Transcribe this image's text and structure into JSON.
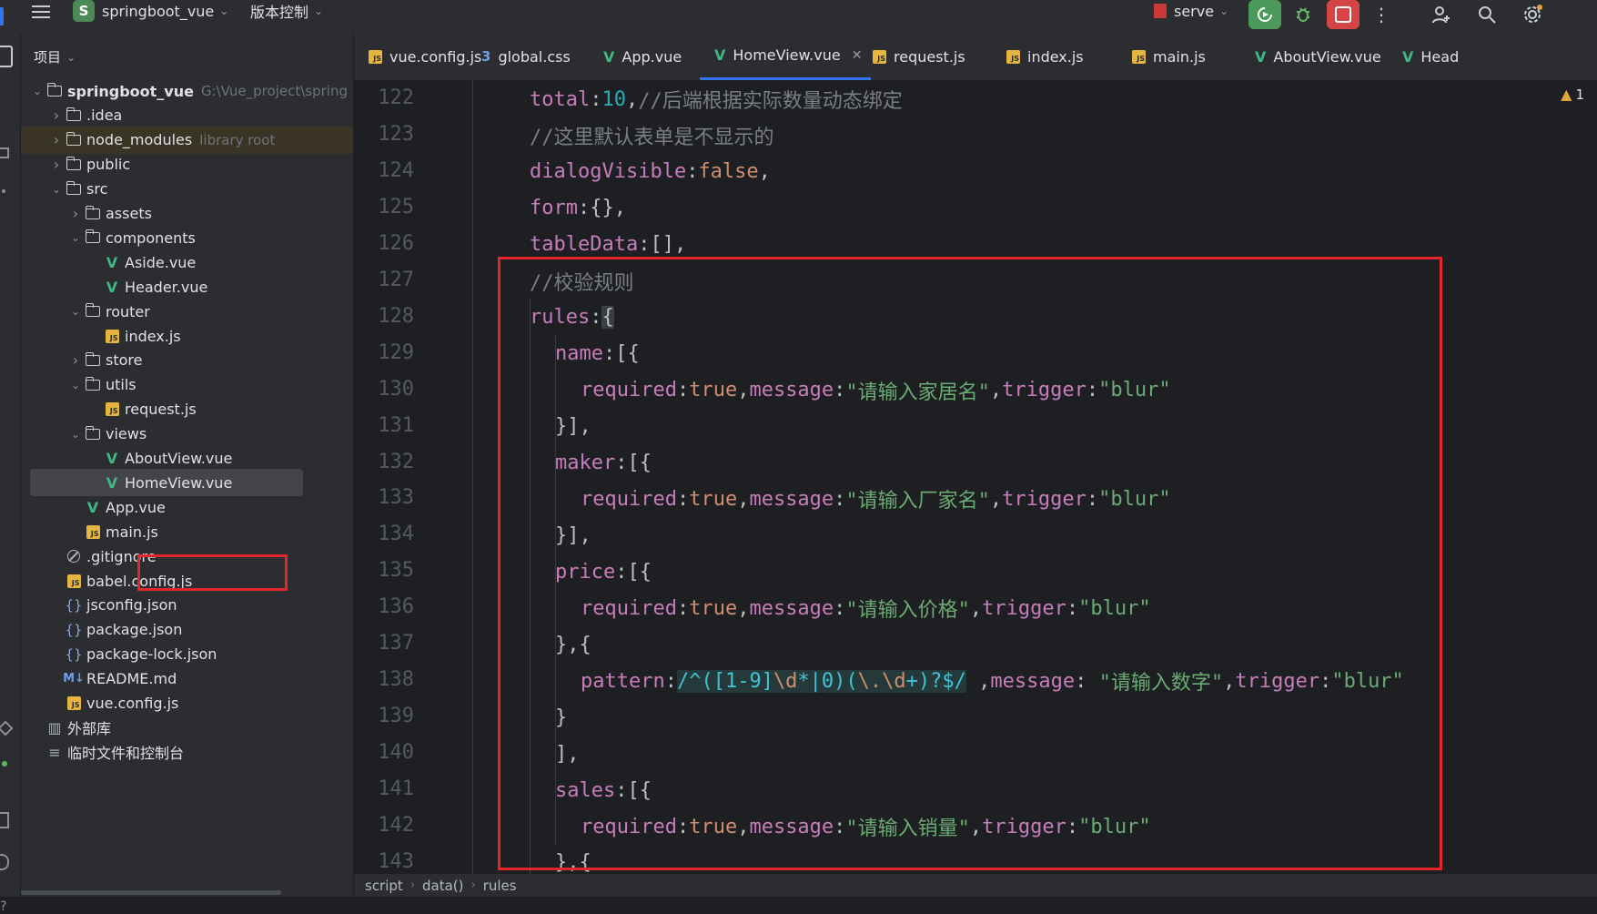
{
  "topbar": {
    "menu_icon": "hamburger-icon",
    "project_badge": "S",
    "project_name": "springboot_vue",
    "vcs_menu": "版本控制",
    "run_config": "serve",
    "colors": {
      "badge": "#4b8a55",
      "run": "#4b9a59",
      "stop": "#d64545"
    }
  },
  "sidebar": {
    "title": "项目",
    "tree": [
      {
        "label": "springboot_vue",
        "hint": "G:\\Vue_project\\spring",
        "icon": "module-folder-icon",
        "depth": 0,
        "expanded": true,
        "bold": true
      },
      {
        "label": ".idea",
        "icon": "folder-icon",
        "depth": 1,
        "expanded": false
      },
      {
        "label": "node_modules",
        "hint": "library root",
        "icon": "folder-icon",
        "depth": 1,
        "expanded": false,
        "highlighted": true
      },
      {
        "label": "public",
        "icon": "folder-icon",
        "depth": 1,
        "expanded": false
      },
      {
        "label": "src",
        "icon": "folder-icon",
        "depth": 1,
        "expanded": true
      },
      {
        "label": "assets",
        "icon": "folder-icon",
        "depth": 2,
        "expanded": false
      },
      {
        "label": "components",
        "icon": "folder-icon",
        "depth": 2,
        "expanded": true
      },
      {
        "label": "Aside.vue",
        "icon": "vue-icon",
        "depth": 3
      },
      {
        "label": "Header.vue",
        "icon": "vue-icon",
        "depth": 3
      },
      {
        "label": "router",
        "icon": "folder-icon",
        "depth": 2,
        "expanded": true
      },
      {
        "label": "index.js",
        "icon": "js-icon",
        "depth": 3
      },
      {
        "label": "store",
        "icon": "folder-icon",
        "depth": 2,
        "expanded": false
      },
      {
        "label": "utils",
        "icon": "folder-icon",
        "depth": 2,
        "expanded": true
      },
      {
        "label": "request.js",
        "icon": "js-icon",
        "depth": 3
      },
      {
        "label": "views",
        "icon": "folder-icon",
        "depth": 2,
        "expanded": true
      },
      {
        "label": "AboutView.vue",
        "icon": "vue-icon",
        "depth": 3
      },
      {
        "label": "HomeView.vue",
        "icon": "vue-icon",
        "depth": 3,
        "selected": true
      },
      {
        "label": "App.vue",
        "icon": "vue-icon",
        "depth": 2
      },
      {
        "label": "main.js",
        "icon": "js-icon",
        "depth": 2
      },
      {
        "label": ".gitignore",
        "icon": "ignore-icon",
        "depth": 1
      },
      {
        "label": "babel.config.js",
        "icon": "js-icon",
        "depth": 1
      },
      {
        "label": "jsconfig.json",
        "icon": "json-icon",
        "depth": 1
      },
      {
        "label": "package.json",
        "icon": "json-icon",
        "depth": 1
      },
      {
        "label": "package-lock.json",
        "icon": "json-icon",
        "depth": 1
      },
      {
        "label": "README.md",
        "icon": "markdown-icon",
        "depth": 1
      },
      {
        "label": "vue.config.js",
        "icon": "js-icon",
        "depth": 1
      },
      {
        "label": "外部库",
        "icon": "library-icon",
        "depth": 0
      },
      {
        "label": "临时文件和控制台",
        "icon": "scratch-icon",
        "depth": 0
      }
    ]
  },
  "tabs": [
    {
      "label": "vue.config.js",
      "icon": "js-icon"
    },
    {
      "label": "global.css",
      "icon": "css-icon"
    },
    {
      "label": "App.vue",
      "icon": "vue-icon"
    },
    {
      "label": "HomeView.vue",
      "icon": "vue-icon",
      "active": true,
      "closable": true
    },
    {
      "label": "request.js",
      "icon": "js-icon"
    },
    {
      "label": "index.js",
      "icon": "js-icon"
    },
    {
      "label": "main.js",
      "icon": "js-icon"
    },
    {
      "label": "AboutView.vue",
      "icon": "vue-icon"
    },
    {
      "label": "Head",
      "icon": "vue-icon"
    }
  ],
  "editor": {
    "warnings": "1",
    "lines": [
      {
        "n": "122",
        "indent": 0,
        "tokens": [
          [
            "total",
            "key"
          ],
          [
            ":",
            "p"
          ],
          [
            "10",
            "num"
          ],
          [
            ",",
            "p"
          ],
          [
            "//后端根据实际数量动态绑定",
            "cmt"
          ]
        ]
      },
      {
        "n": "123",
        "indent": 0,
        "tokens": [
          [
            "//这里默认表单是不显示的",
            "cmt"
          ]
        ]
      },
      {
        "n": "124",
        "indent": 0,
        "tokens": [
          [
            "dialogVisible",
            "key"
          ],
          [
            ":",
            "p"
          ],
          [
            "false",
            "kw"
          ],
          [
            ",",
            "p"
          ]
        ]
      },
      {
        "n": "125",
        "indent": 0,
        "tokens": [
          [
            "form",
            "key"
          ],
          [
            ":{},",
            "p"
          ]
        ]
      },
      {
        "n": "126",
        "indent": 0,
        "tokens": [
          [
            "tableData",
            "key"
          ],
          [
            ":[],",
            "p"
          ]
        ]
      },
      {
        "n": "127",
        "indent": 0,
        "tokens": [
          [
            "//校验规则",
            "cmt"
          ]
        ]
      },
      {
        "n": "128",
        "indent": 0,
        "tokens": [
          [
            "rules",
            "key"
          ],
          [
            ":",
            "p"
          ],
          [
            "{",
            "caret"
          ]
        ]
      },
      {
        "n": "129",
        "indent": 1,
        "tokens": [
          [
            "name",
            "key"
          ],
          [
            ":[{",
            "p"
          ]
        ]
      },
      {
        "n": "130",
        "indent": 2,
        "tokens": [
          [
            "required",
            "key"
          ],
          [
            ":",
            "p"
          ],
          [
            "true",
            "kw"
          ],
          [
            ",",
            "p"
          ],
          [
            "message",
            "key"
          ],
          [
            ":",
            "p"
          ],
          [
            "\"请输入家居名\"",
            "str"
          ],
          [
            ",",
            "p"
          ],
          [
            "trigger",
            "key"
          ],
          [
            ":",
            "p"
          ],
          [
            "\"blur\"",
            "str"
          ]
        ]
      },
      {
        "n": "131",
        "indent": 1,
        "tokens": [
          [
            "}],",
            "p"
          ]
        ]
      },
      {
        "n": "132",
        "indent": 1,
        "tokens": [
          [
            "maker",
            "key"
          ],
          [
            ":[{",
            "p"
          ]
        ]
      },
      {
        "n": "133",
        "indent": 2,
        "tokens": [
          [
            "required",
            "key"
          ],
          [
            ":",
            "p"
          ],
          [
            "true",
            "kw"
          ],
          [
            ",",
            "p"
          ],
          [
            "message",
            "key"
          ],
          [
            ":",
            "p"
          ],
          [
            "\"请输入厂家名\"",
            "str"
          ],
          [
            ",",
            "p"
          ],
          [
            "trigger",
            "key"
          ],
          [
            ":",
            "p"
          ],
          [
            "\"blur\"",
            "str"
          ]
        ]
      },
      {
        "n": "134",
        "indent": 1,
        "tokens": [
          [
            "}],",
            "p"
          ]
        ]
      },
      {
        "n": "135",
        "indent": 1,
        "tokens": [
          [
            "price",
            "key"
          ],
          [
            ":[{",
            "p"
          ]
        ]
      },
      {
        "n": "136",
        "indent": 2,
        "tokens": [
          [
            "required",
            "key"
          ],
          [
            ":",
            "p"
          ],
          [
            "true",
            "kw"
          ],
          [
            ",",
            "p"
          ],
          [
            "message",
            "key"
          ],
          [
            ":",
            "p"
          ],
          [
            "\"请输入价格\"",
            "str"
          ],
          [
            ",",
            "p"
          ],
          [
            "trigger",
            "key"
          ],
          [
            ":",
            "p"
          ],
          [
            "\"blur\"",
            "str"
          ]
        ]
      },
      {
        "n": "137",
        "indent": 1,
        "tokens": [
          [
            "},{",
            "p"
          ]
        ]
      },
      {
        "n": "138",
        "indent": 2,
        "tokens": [
          [
            "pattern",
            "key"
          ],
          [
            ":",
            "p"
          ],
          [
            "/^([1-9]",
            "re"
          ],
          [
            "\\d",
            "reesc"
          ],
          [
            "*|0)(",
            "re"
          ],
          [
            "\\.\\d",
            "reesc"
          ],
          [
            "+)?$/",
            "re"
          ],
          [
            " ,",
            "p"
          ],
          [
            "message",
            "key"
          ],
          [
            ": ",
            "p"
          ],
          [
            "\"请输入数字\"",
            "str"
          ],
          [
            ",",
            "p"
          ],
          [
            "trigger",
            "key"
          ],
          [
            ":",
            "p"
          ],
          [
            "\"blur\"",
            "str"
          ]
        ]
      },
      {
        "n": "139",
        "indent": 1,
        "tokens": [
          [
            "}",
            "p"
          ]
        ]
      },
      {
        "n": "140",
        "indent": 1,
        "tokens": [
          [
            "],",
            "p"
          ]
        ]
      },
      {
        "n": "141",
        "indent": 1,
        "tokens": [
          [
            "sales",
            "key"
          ],
          [
            ":[{",
            "p"
          ]
        ]
      },
      {
        "n": "142",
        "indent": 2,
        "tokens": [
          [
            "required",
            "key"
          ],
          [
            ":",
            "p"
          ],
          [
            "true",
            "kw"
          ],
          [
            ",",
            "p"
          ],
          [
            "message",
            "key"
          ],
          [
            ":",
            "p"
          ],
          [
            "\"请输入销量\"",
            "str"
          ],
          [
            ",",
            "p"
          ],
          [
            "trigger",
            "key"
          ],
          [
            ":",
            "p"
          ],
          [
            "\"blur\"",
            "str"
          ]
        ]
      },
      {
        "n": "143",
        "indent": 1,
        "tokens": [
          [
            "},{",
            "p"
          ]
        ]
      }
    ]
  },
  "statusbar": {
    "breadcrumbs": [
      "script",
      "data()",
      "rules"
    ]
  }
}
